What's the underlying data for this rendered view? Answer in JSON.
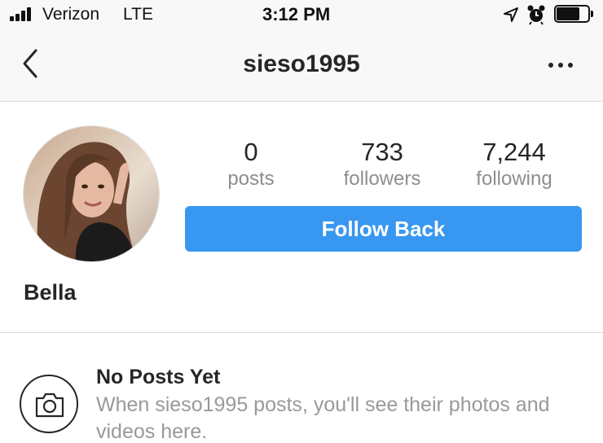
{
  "status_bar": {
    "carrier": "Verizon",
    "network": "LTE",
    "time": "3:12 PM",
    "icons": [
      "signal-icon",
      "location-icon",
      "alarm-icon",
      "battery-icon"
    ]
  },
  "nav": {
    "title": "sieso1995",
    "back_icon": "chevron-left-icon",
    "more_icon": "more-horizontal-icon"
  },
  "profile": {
    "display_name": "Bella",
    "stats": {
      "posts": {
        "value": "0",
        "label": "posts"
      },
      "followers": {
        "value": "733",
        "label": "followers"
      },
      "following": {
        "value": "7,244",
        "label": "following"
      }
    },
    "follow_button_label": "Follow Back"
  },
  "empty_state": {
    "icon": "camera-icon",
    "title": "No Posts Yet",
    "description": "When sieso1995 posts, you'll see their photos and videos here."
  },
  "colors": {
    "accent": "#3897f0",
    "text_primary": "#262626",
    "text_secondary": "#8e8e8e",
    "divider": "#dbdbdb",
    "bar_background": "#f8f8f8"
  }
}
